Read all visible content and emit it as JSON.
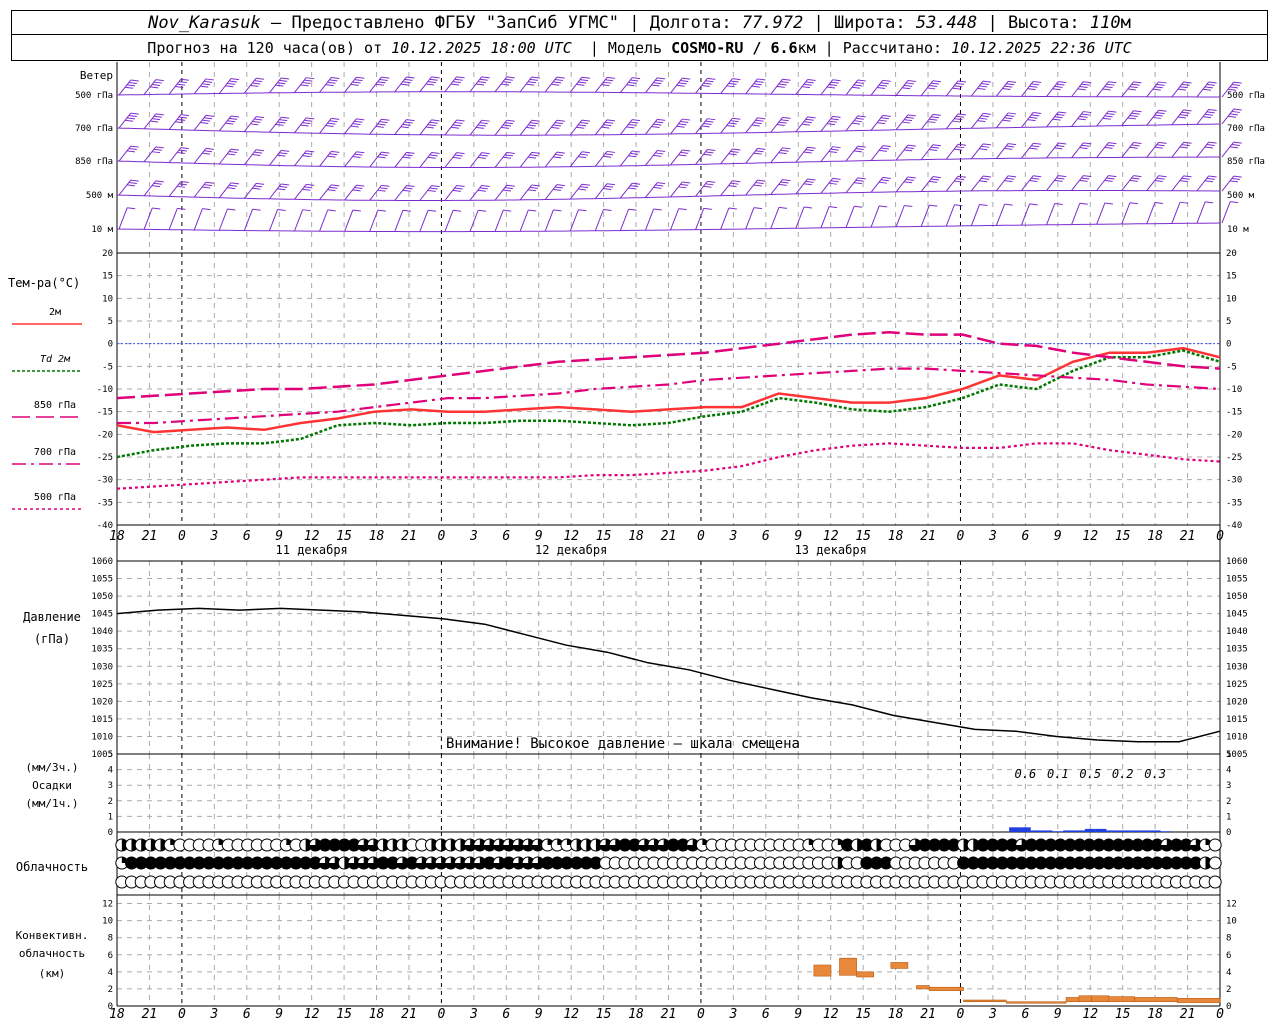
{
  "header": {
    "station": "Nov_Karasuk",
    "provider": " – Предоставлено ФГБУ \"ЗапСиб УГМС\" | Долгота: ",
    "lon": "77.972",
    "lat_label": " | Широта: ",
    "lat": "53.448",
    "alt_label": " | Высота: ",
    "alt": "110",
    "alt_unit": "м",
    "fc_label": "Прогноз на 120 часа(ов) от ",
    "fc_time": "10.12.2025 18:00 UTC",
    "model_label": "  | Модель ",
    "model": "COSMO-RU / 6.6",
    "model_unit": "км",
    "calc_label": " | Рассчитано: ",
    "calc_time": "10.12.2025 22:36 UTC"
  },
  "chart_data": [
    {
      "type": "line",
      "panel": "wind",
      "title": "Ветер",
      "levels": [
        "500 гПа",
        "700 гПа",
        "850 гПа",
        "500 м",
        "10  м"
      ],
      "x_hours_from_start": [
        0,
        6,
        12,
        18,
        24,
        30,
        36,
        42,
        48,
        54,
        60,
        66,
        72,
        78,
        84,
        90,
        96,
        102,
        108,
        114,
        120,
        126,
        132,
        138,
        144,
        150,
        156,
        162,
        168,
        174,
        180,
        186,
        192,
        198,
        204,
        210,
        216,
        222,
        228,
        234,
        240,
        246,
        252,
        258,
        264
      ],
      "series": [
        {
          "name": "500 гПа",
          "values": [
            40,
            40,
            40,
            40,
            40,
            40,
            40,
            40,
            40,
            40,
            40,
            40,
            40,
            40,
            40,
            40,
            40,
            40,
            40,
            40,
            40,
            40,
            40,
            40,
            40,
            40,
            40,
            40,
            40,
            40,
            40,
            40,
            40,
            40,
            40,
            40,
            40,
            40,
            40,
            40,
            40,
            40,
            40,
            40,
            40
          ]
        },
        {
          "name": "700 гПа",
          "values": [
            35,
            35,
            35,
            35,
            35,
            35,
            35,
            35,
            35,
            35,
            35,
            35,
            35,
            35,
            35,
            35,
            35,
            35,
            35,
            35,
            35,
            35,
            35,
            35,
            35,
            35,
            35,
            35,
            35,
            35,
            35,
            35,
            35,
            35,
            35,
            35,
            35,
            35,
            35,
            35,
            35,
            35,
            35,
            35,
            35
          ]
        },
        {
          "name": "850 гПа",
          "values": [
            30,
            30,
            30,
            30,
            30,
            30,
            30,
            30,
            30,
            30,
            30,
            30,
            30,
            30,
            30,
            30,
            30,
            30,
            30,
            30,
            30,
            30,
            30,
            30,
            30,
            30,
            30,
            30,
            30,
            30,
            30,
            30,
            30,
            30,
            30,
            30,
            30,
            30,
            30,
            30,
            30,
            30,
            30,
            30,
            30
          ]
        },
        {
          "name": "500 м",
          "values": [
            25,
            25,
            25,
            25,
            25,
            25,
            25,
            25,
            25,
            25,
            25,
            25,
            25,
            25,
            25,
            25,
            25,
            25,
            25,
            25,
            25,
            25,
            25,
            25,
            25,
            25,
            25,
            25,
            25,
            25,
            25,
            25,
            25,
            25,
            25,
            25,
            25,
            25,
            25,
            25,
            25,
            25,
            25,
            25,
            25
          ]
        },
        {
          "name": "10  м",
          "values": [
            10,
            10,
            10,
            10,
            10,
            10,
            10,
            10,
            10,
            10,
            10,
            10,
            10,
            10,
            10,
            10,
            10,
            10,
            10,
            10,
            10,
            10,
            10,
            10,
            10,
            10,
            10,
            10,
            10,
            10,
            10,
            10,
            10,
            10,
            10,
            10,
            10,
            10,
            10,
            10,
            10,
            10,
            10,
            10,
            10
          ]
        }
      ]
    },
    {
      "type": "line",
      "panel": "temperature",
      "ylabel": "Тем-ра(°C)",
      "ylim": [
        -40,
        20
      ],
      "yticks": [
        20,
        15,
        10,
        5,
        0,
        -5,
        -10,
        -15,
        -20,
        -25,
        -30,
        -35,
        -40
      ],
      "x": [
        0,
        6,
        12,
        18,
        24,
        30,
        36,
        42,
        48,
        54,
        60,
        66,
        72,
        78,
        84,
        90,
        96,
        102,
        108,
        114,
        120,
        126,
        132,
        138,
        144,
        150,
        156,
        162,
        168,
        174,
        180
      ],
      "series": [
        {
          "name": "2м",
          "color": "#ff3333",
          "values": [
            -18,
            -19.5,
            -19,
            -18.5,
            -19,
            -17.5,
            -16.5,
            -15,
            -14.5,
            -15,
            -15,
            -14.5,
            -14,
            -14.5,
            -15,
            -14.5,
            -14,
            -14,
            -11,
            -12,
            -13,
            -13,
            -12,
            -10,
            -7,
            -8,
            -4,
            -2,
            -2,
            -1,
            -3
          ]
        },
        {
          "name": "Td  2м",
          "color": "#007700",
          "values": [
            -25,
            -23.5,
            -22.5,
            -22,
            -22,
            -21,
            -18,
            -17.5,
            -18,
            -17.5,
            -17.5,
            -17,
            -17,
            -17.5,
            -18,
            -17.5,
            -16,
            -15,
            -12,
            -13,
            -14.5,
            -15,
            -14,
            -12,
            -9,
            -10,
            -6,
            -3,
            -3,
            -1.5,
            -4
          ]
        },
        {
          "name": "850 гПа",
          "color": "#e0007a",
          "values": [
            -12,
            -11.5,
            -11,
            -10.5,
            -10,
            -10,
            -9.5,
            -9,
            -8,
            -7,
            -6,
            -5,
            -4,
            -3.5,
            -3,
            -2.5,
            -2,
            -1,
            0,
            1,
            2,
            2.5,
            2,
            2,
            0,
            -0.5,
            -2,
            -3,
            -4,
            -5,
            -5.5
          ]
        },
        {
          "name": "700 гПа",
          "color": "#e0007a",
          "values": [
            -17.5,
            -17.5,
            -17,
            -16.5,
            -16,
            -15.5,
            -15,
            -14,
            -13,
            -12,
            -12,
            -11.5,
            -11,
            -10,
            -9.5,
            -9,
            -8,
            -7.5,
            -7,
            -6.5,
            -6,
            -5.5,
            -5.5,
            -6,
            -6.5,
            -7,
            -7.5,
            -8,
            -9,
            -9.5,
            -10
          ]
        },
        {
          "name": "500 гПа",
          "color": "#e0007a",
          "values": [
            -32,
            -31.5,
            -31,
            -30.5,
            -30,
            -29.5,
            -29.5,
            -29.5,
            -29.5,
            -29.5,
            -29.5,
            -29.5,
            -29.5,
            -29,
            -29,
            -28.5,
            -28,
            -27,
            -25,
            -23.5,
            -22.5,
            -22,
            -22.5,
            -23,
            -23,
            -22,
            -22,
            -23.5,
            -24.5,
            -25.5,
            -26
          ]
        }
      ],
      "xticks": [
        "18",
        "21",
        "0",
        "3",
        "6",
        "9",
        "12",
        "15",
        "18",
        "21",
        "0",
        "3",
        "6",
        "9",
        "12",
        "15",
        "18",
        "21",
        "0",
        "3",
        "6",
        "9",
        "12",
        "15",
        "18",
        "21",
        "0",
        "3",
        "6",
        "9",
        "12",
        "15",
        "18",
        "21",
        "0"
      ],
      "day_labels": [
        "11 декабря",
        "12 декабря",
        "13 декабря"
      ]
    },
    {
      "type": "line",
      "panel": "pressure",
      "ylabel": "Давление",
      "ylabel2": "(гПа)",
      "ylim": [
        1005,
        1060
      ],
      "yticks": [
        1060,
        1055,
        1050,
        1045,
        1040,
        1035,
        1030,
        1025,
        1020,
        1015,
        1010,
        1005
      ],
      "x": [
        0,
        6,
        12,
        18,
        24,
        30,
        36,
        42,
        48,
        54,
        60,
        66,
        72,
        78,
        84,
        90,
        96,
        102,
        108,
        114,
        120,
        126,
        132,
        138,
        144,
        150,
        156,
        162
      ],
      "values": [
        1045,
        1046,
        1046.5,
        1046,
        1046.5,
        1046,
        1045.5,
        1044.5,
        1043.5,
        1042,
        1039,
        1036,
        1034,
        1031,
        1029,
        1026,
        1023.5,
        1021,
        1019,
        1016,
        1014,
        1012,
        1011.5,
        1010,
        1009,
        1008.5,
        1008.5,
        1011.5
      ],
      "note": "Внимание! Высокое давление – шкала смещена"
    },
    {
      "type": "bar",
      "panel": "precipitation",
      "ylabel": "(мм/3ч.)",
      "ylabel2": "Осадки",
      "ylabel3": "(мм/1ч.)",
      "ylim": [
        0,
        5
      ],
      "yticks": [
        5,
        4,
        3,
        2,
        1,
        0
      ],
      "totals_3h": [
        "0.6",
        "0.1",
        "0.5",
        "0.2",
        "0.3"
      ],
      "bars_1h": [
        0.3,
        0.3,
        0.1,
        0.1,
        0.05,
        0.1,
        0.1,
        0.2,
        0.2,
        0.1,
        0.1,
        0.1,
        0.1,
        0.1,
        0.05
      ]
    },
    {
      "type": "table",
      "panel": "cloud",
      "ylabel": "Облачность",
      "rows": [
        {
          "name": "upper",
          "cover": [
            4,
            4,
            4,
            4,
            4,
            2,
            0,
            0,
            0,
            0,
            2,
            0,
            0,
            0,
            0,
            0,
            0,
            2,
            0,
            4,
            6,
            8,
            8,
            8,
            8,
            6,
            6,
            4,
            4,
            4,
            0,
            0,
            4,
            4,
            4,
            4,
            6,
            6,
            6,
            6,
            6,
            6,
            6,
            6,
            2,
            2,
            2,
            4,
            4,
            4,
            6,
            6,
            8,
            8,
            6,
            6,
            6,
            8,
            8,
            6,
            2,
            0,
            0,
            0,
            0,
            0,
            0,
            0,
            0,
            0,
            0,
            2,
            0,
            0,
            2,
            8,
            4,
            8,
            4,
            0,
            0,
            0,
            6,
            8,
            8,
            8,
            8,
            4,
            4,
            8,
            8,
            8,
            8,
            6,
            8,
            8,
            8,
            8,
            8,
            8,
            8,
            8,
            8,
            8,
            8,
            8,
            8,
            8,
            6,
            8,
            8,
            6,
            2,
            0
          ]
        },
        {
          "name": "middle",
          "cover": [
            2,
            8,
            8,
            8,
            8,
            8,
            8,
            8,
            8,
            8,
            8,
            8,
            8,
            8,
            8,
            8,
            8,
            8,
            8,
            8,
            8,
            6,
            6,
            4,
            6,
            6,
            6,
            8,
            8,
            6,
            8,
            6,
            6,
            6,
            6,
            6,
            6,
            6,
            8,
            6,
            8,
            6,
            6,
            6,
            8,
            8,
            8,
            8,
            8,
            8,
            0,
            0,
            0,
            0,
            0,
            0,
            0,
            0,
            0,
            0,
            0,
            0,
            0,
            0,
            0,
            0,
            0,
            0,
            0,
            0,
            0,
            0,
            0,
            0,
            4,
            0,
            0,
            8,
            8,
            8,
            0,
            0,
            0,
            0,
            0,
            0,
            0,
            8,
            8,
            8,
            8,
            8,
            8,
            8,
            8,
            8,
            8,
            8,
            8,
            8,
            8,
            8,
            8,
            8,
            8,
            8,
            8,
            8,
            8,
            8,
            8,
            8,
            4,
            0
          ]
        },
        {
          "name": "lower",
          "cover": [
            0,
            0,
            0,
            0,
            0,
            0,
            0,
            0,
            0,
            0,
            0,
            0,
            0,
            0,
            0,
            0,
            0,
            0,
            0,
            0,
            0,
            0,
            0,
            0,
            0,
            0,
            0,
            0,
            0,
            0,
            0,
            0,
            0,
            0,
            0,
            0,
            0,
            0,
            0,
            0,
            0,
            0,
            0,
            0,
            0,
            0,
            0,
            0,
            0,
            0,
            0,
            0,
            0,
            0,
            0,
            0,
            0,
            0,
            0,
            0,
            0,
            0,
            0,
            0,
            0,
            0,
            0,
            0,
            0,
            0,
            0,
            0,
            0,
            0,
            0,
            0,
            0,
            0,
            0,
            0,
            0,
            0,
            0,
            0,
            0,
            0,
            0,
            0,
            0,
            0,
            0,
            0,
            0,
            0,
            0,
            0,
            0,
            0,
            0,
            0,
            0,
            0,
            0,
            0,
            0,
            0,
            0,
            0,
            0,
            0,
            0,
            0,
            0,
            0
          ]
        }
      ]
    },
    {
      "type": "bar",
      "panel": "convective",
      "ylabel": "Конвективн.",
      "ylabel2": "облачность",
      "ylabel3": "(км)",
      "ylim": [
        0,
        13
      ],
      "yticks": [
        12,
        10,
        8,
        6,
        4,
        2,
        0
      ],
      "bars": [
        {
          "from_h": 81.5,
          "to_h": 83.5,
          "bottom": 3.5,
          "top": 4.8
        },
        {
          "from_h": 84.5,
          "to_h": 86.5,
          "bottom": 3.6,
          "top": 5.6
        },
        {
          "from_h": 86.5,
          "to_h": 88.5,
          "bottom": 3.4,
          "top": 4.0
        },
        {
          "from_h": 90.5,
          "to_h": 92.5,
          "bottom": 4.4,
          "top": 5.1
        },
        {
          "from_h": 93.5,
          "to_h": 95,
          "bottom": 2.0,
          "top": 2.4
        },
        {
          "from_h": 95,
          "to_h": 99,
          "bottom": 1.8,
          "top": 2.2
        },
        {
          "from_h": 99,
          "to_h": 104,
          "bottom": 0.5,
          "top": 0.7
        },
        {
          "from_h": 104,
          "to_h": 111,
          "bottom": 0.4,
          "top": 0.5
        },
        {
          "from_h": 111,
          "to_h": 112.5,
          "bottom": 0.5,
          "top": 1.0
        },
        {
          "from_h": 112.5,
          "to_h": 114,
          "bottom": 0.5,
          "top": 1.2
        },
        {
          "from_h": 114,
          "to_h": 116,
          "bottom": 0.5,
          "top": 1.2
        },
        {
          "from_h": 116,
          "to_h": 119,
          "bottom": 0.5,
          "top": 1.1
        },
        {
          "from_h": 119,
          "to_h": 124,
          "bottom": 0.5,
          "top": 1.0
        },
        {
          "from_h": 124,
          "to_h": 129,
          "bottom": 0.4,
          "top": 0.9
        }
      ]
    }
  ]
}
